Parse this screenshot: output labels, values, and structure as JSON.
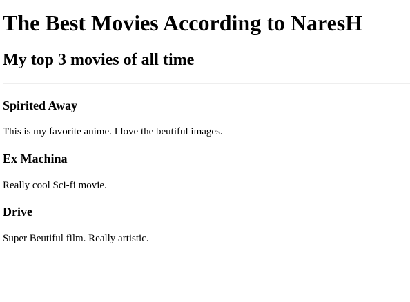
{
  "page": {
    "title": "The Best Movies According to NaresH",
    "subtitle": "My top 3 movies of all time"
  },
  "movies": [
    {
      "title": "Spirited Away",
      "description": "This is my favorite anime. I love the beutiful images."
    },
    {
      "title": "Ex Machina",
      "description": "Really cool Sci-fi movie."
    },
    {
      "title": "Drive",
      "description": "Super Beutiful film. Really artistic."
    }
  ]
}
